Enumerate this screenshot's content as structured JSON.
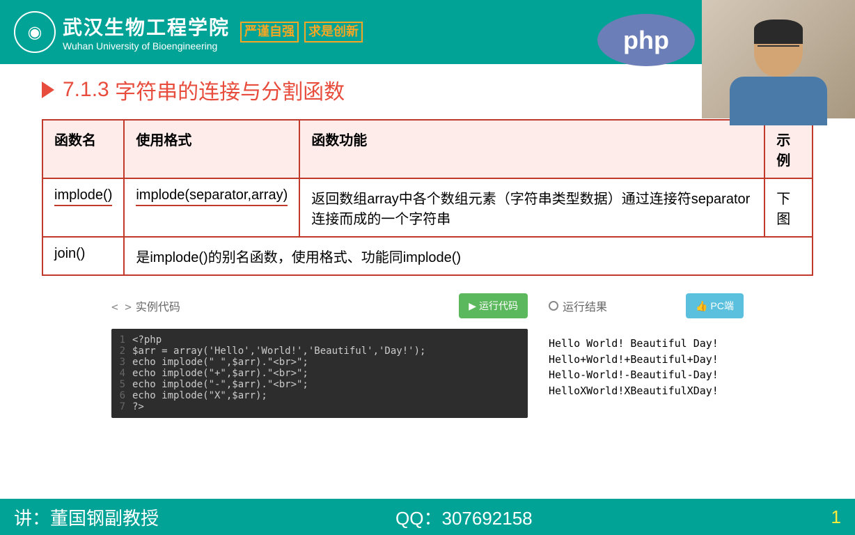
{
  "header": {
    "university_cn": "武汉生物工程学院",
    "university_en": "Wuhan University of Bioengineering",
    "motto1": "严谨自强",
    "motto2": "求是创新",
    "php_label": "php"
  },
  "section": {
    "number": "7.1.3",
    "title": "字符串的连接与分割函数"
  },
  "table": {
    "headers": [
      "函数名",
      "使用格式",
      "函数功能",
      "示例"
    ],
    "rows": [
      {
        "name": "implode()",
        "format": "implode(separator,array)",
        "desc": "返回数组array中各个数组元素（字符串类型数据）通过连接符separator连接而成的一个字符串",
        "example": "下图"
      },
      {
        "name": "join()",
        "format_colspan": "是implode()的别名函数，使用格式、功能同implode()"
      }
    ]
  },
  "code": {
    "label": "实例代码",
    "run_btn": "运行代码",
    "result_label": "运行结果",
    "pc_btn": "PC端",
    "lines": [
      "<?php",
      "$arr = array('Hello','World!','Beautiful','Day!');",
      "echo implode(\" \",$arr).\"<br>\";",
      "echo implode(\"+\",$arr).\"<br>\";",
      "echo implode(\"-\",$arr).\"<br>\";",
      "echo implode(\"X\",$arr);",
      "?>"
    ],
    "output": [
      "Hello World! Beautiful Day!",
      "Hello+World!+Beautiful+Day!",
      "Hello-World!-Beautiful-Day!",
      "HelloXWorld!XBeautifulXDay!"
    ]
  },
  "footer": {
    "lecturer_label": "讲：",
    "lecturer_name": "董国钢副教授",
    "qq_label": "QQ：",
    "qq_number": "307692158",
    "right_num": "1"
  }
}
